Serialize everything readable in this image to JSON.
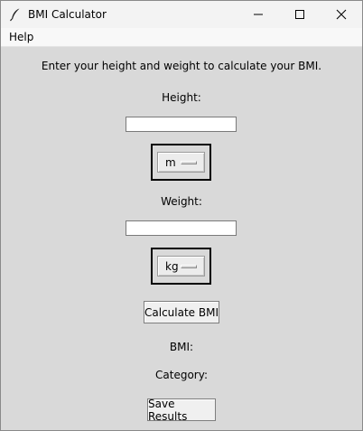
{
  "window": {
    "title": "BMI Calculator",
    "icons": {
      "app": "feather-icon",
      "minimize": "minimize-icon",
      "maximize": "maximize-icon",
      "close": "close-icon"
    }
  },
  "menu": {
    "items": [
      "Help"
    ]
  },
  "form": {
    "instruction": "Enter your height and weight to calculate your BMI.",
    "height_label": "Height:",
    "height_value": "",
    "height_unit": "m",
    "weight_label": "Weight:",
    "weight_value": "",
    "weight_unit": "kg",
    "calculate_label": "Calculate BMI",
    "bmi_label": "BMI:",
    "category_label": "Category:",
    "save_label": "Save Results"
  }
}
